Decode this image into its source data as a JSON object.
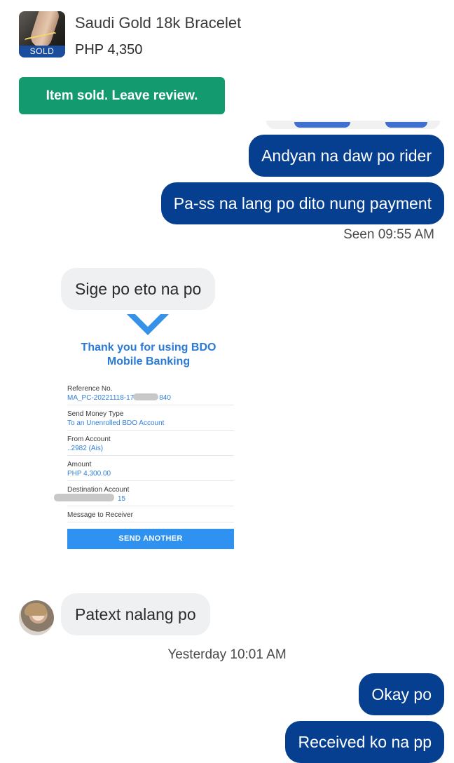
{
  "listing": {
    "title": "Saudi Gold 18k Bracelet",
    "price": "PHP 4,350",
    "status_tag": "SOLD",
    "action_label": "Item sold. Leave review."
  },
  "messages": [
    {
      "side": "me",
      "text": "Andyan na daw po rider"
    },
    {
      "side": "me",
      "text": "Pa-ss na lang po dito nung payment"
    },
    {
      "side": "them",
      "text": "Sige po eto na po"
    },
    {
      "side": "them",
      "text": "Patext nalang po"
    },
    {
      "side": "me",
      "text": "Okay po"
    },
    {
      "side": "me",
      "text": "Received ko na pp"
    }
  ],
  "meta": {
    "seen": "Seen 09:55 AM",
    "timestamp": "Yesterday 10:01 AM"
  },
  "receipt": {
    "thanks_line1": "Thank you for using BDO",
    "thanks_line2": "Mobile Banking",
    "fields": [
      {
        "label": "Reference No.",
        "value_a": "MA_PC-20221118-17",
        "value_b": "840"
      },
      {
        "label": "Send Money Type",
        "value": "To an Unenrolled BDO Account"
      },
      {
        "label": "From Account",
        "value": "..2982  (Ais)"
      },
      {
        "label": "Amount",
        "value": "PHP 4,300.00"
      },
      {
        "label": "Destination Account",
        "value_b": "15"
      },
      {
        "label": "Message to Receiver"
      }
    ],
    "button": "SEND ANOTHER"
  },
  "colors": {
    "my_bubble": "#063f8f",
    "their_bubble": "#eef0f2",
    "review_button": "#149a6f",
    "sold_tag": "#1b4d9e",
    "bdo_blue": "#2f92f0"
  }
}
